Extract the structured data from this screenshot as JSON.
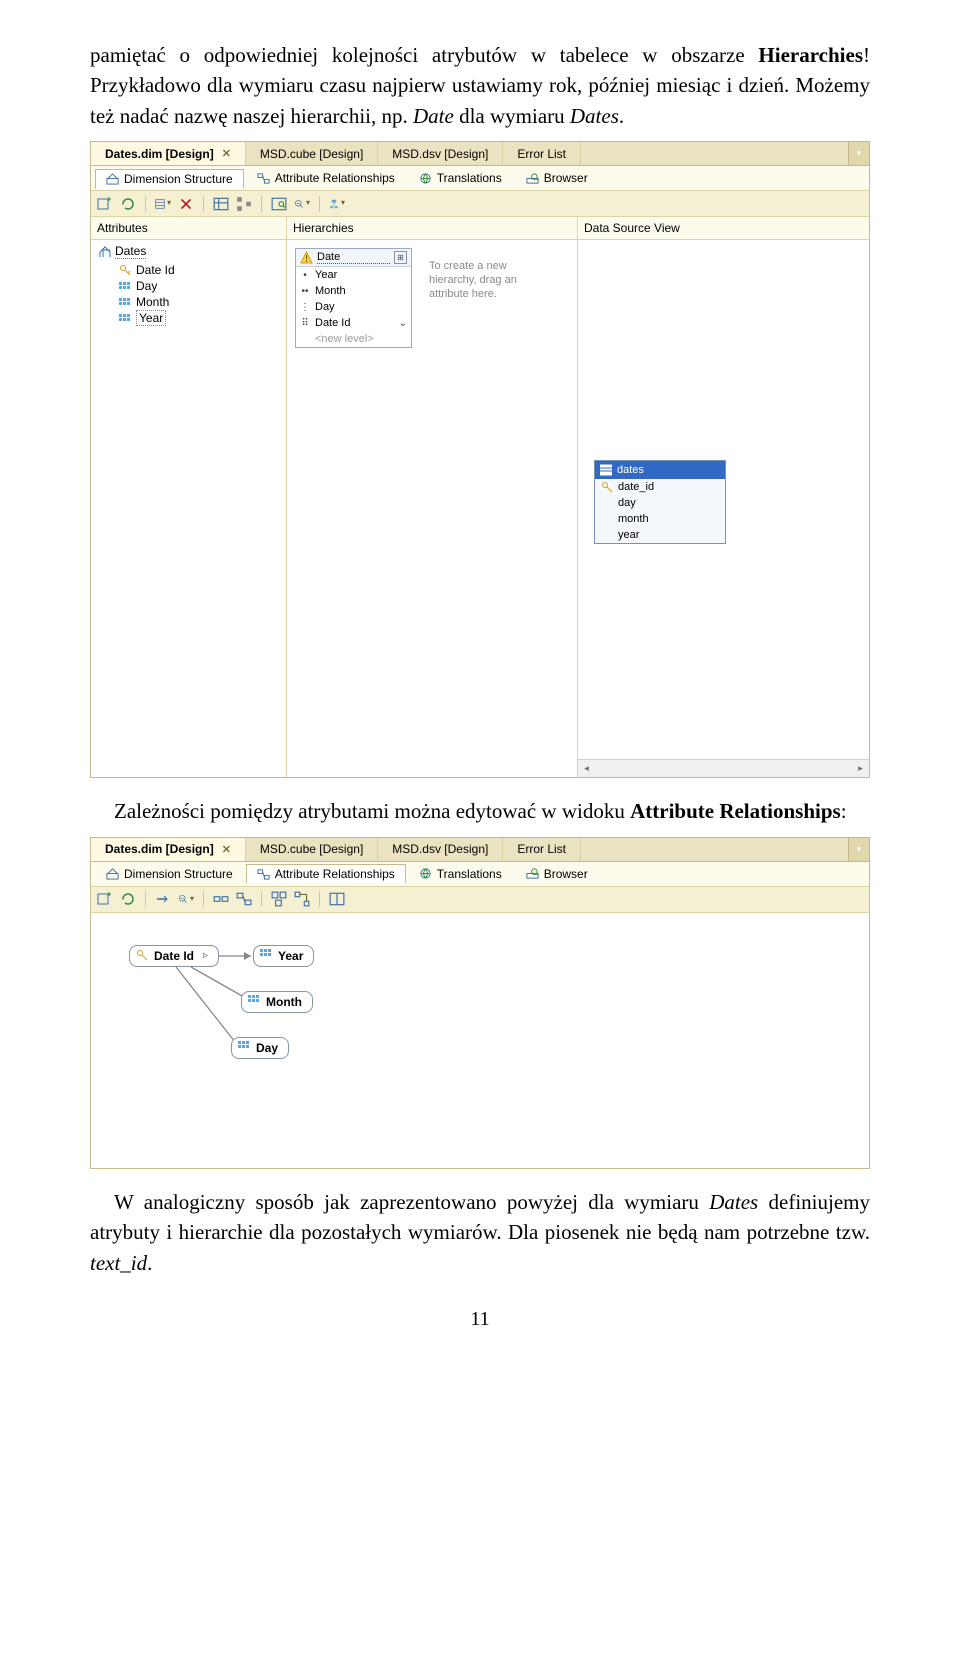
{
  "para1_a": "pamiętać o odpowiedniej kolejności atrybutów w tabelece w obszarze ",
  "para1_b": "Hierarchies",
  "para1_c": "! Przykładowo dla wymiaru czasu najpierw ustawiamy rok, później miesiąc i dzień. Możemy też nadać nazwę naszej hierarchii, np. ",
  "para1_d": "Date",
  "para1_e": " dla wymiaru ",
  "para1_f": "Dates",
  "para1_g": ".",
  "para2_a": "Zależności pomiędzy atrybutami można edytować w widoku ",
  "para2_b": "Attribute Relationships",
  "para2_c": ":",
  "para3_a": "W analogiczny sposób jak zaprezentowano powyżej dla wymiaru ",
  "para3_b": "Dates",
  "para3_c": " definiujemy atrybuty i hierarchie dla pozostałych wymiarów. Dla piosenek nie będą nam potrzebne tzw. ",
  "para3_d": "text_id",
  "para3_e": ".",
  "page_number": "11",
  "tabs": {
    "active": "Dates.dim [Design]",
    "t2": "MSD.cube [Design]",
    "t3": "MSD.dsv [Design]",
    "t4": "Error List"
  },
  "subtabs": {
    "s1": "Dimension Structure",
    "s2": "Attribute Relationships",
    "s3": "Translations",
    "s4": "Browser"
  },
  "panes": {
    "attributes": "Attributes",
    "hierarchies": "Hierarchies",
    "dsv": "Data Source View"
  },
  "attr_tree": {
    "root": "Dates",
    "date_id": "Date Id",
    "day": "Day",
    "month": "Month",
    "year": "Year"
  },
  "hierarchy_card": {
    "name": "Date",
    "levels": {
      "year": "Year",
      "month": "Month",
      "day": "Day",
      "date_id": "Date Id"
    },
    "new_level": "<new level>"
  },
  "hier_hint": "To create a new hierarchy, drag an attribute here.",
  "dsv_table": {
    "name": "dates",
    "cols": {
      "date_id": "date_id",
      "day": "day",
      "month": "month",
      "year": "year"
    }
  },
  "rel_nodes": {
    "date_id": "Date Id",
    "year": "Year",
    "month": "Month",
    "day": "Day"
  }
}
